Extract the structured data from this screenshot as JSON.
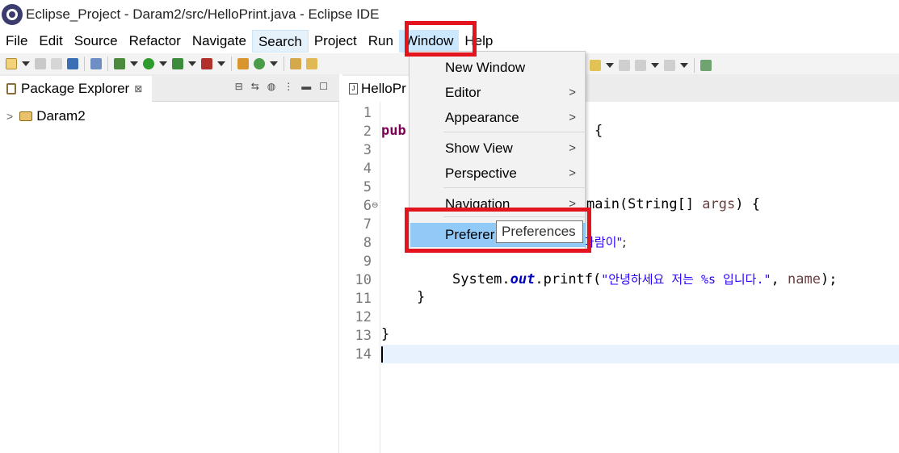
{
  "window": {
    "title": "Eclipse_Project - Daram2/src/HelloPrint.java - Eclipse IDE"
  },
  "menubar": [
    "File",
    "Edit",
    "Source",
    "Refactor",
    "Navigate",
    "Search",
    "Project",
    "Run",
    "Window",
    "Help"
  ],
  "left_panel": {
    "tab_label": "Package Explorer",
    "tab_close": "⊠",
    "project": "Daram2"
  },
  "editor": {
    "tab_label": "HelloPr",
    "line_numbers": [
      "1",
      "2",
      "3",
      "4",
      "5",
      "6",
      "7",
      "8",
      "9",
      "10",
      "11",
      "12",
      "13",
      "14"
    ],
    "lines": {
      "l2_kw": "pub",
      "l2_rest": "{",
      "l6_a": "main(String[] ",
      "l6_var": "args",
      "l6_b": ") {",
      "l8_str": "다람이\"",
      "l8_rest": ";",
      "l10_a": "System.",
      "l10_fld": "out",
      "l10_b": ".printf(",
      "l10_str": "\"안녕하세요 저는 %s 입니다.\"",
      "l10_c": ", ",
      "l10_var": "name",
      "l10_d": ");",
      "l11": "}",
      "l13": "}"
    }
  },
  "window_menu": {
    "items": [
      {
        "label": "New Window",
        "submenu": false
      },
      {
        "label": "Editor",
        "submenu": true
      },
      {
        "label": "Appearance",
        "submenu": true
      },
      {
        "label": "Show View",
        "submenu": true
      },
      {
        "label": "Perspective",
        "submenu": true
      },
      {
        "label": "Navigation",
        "submenu": true
      },
      {
        "label": "Preferer",
        "submenu": false
      }
    ],
    "submenu_glyph": ">"
  },
  "tooltip": "Preferences",
  "colors": {
    "highlight_red": "#e3141e",
    "menu_selected": "#91c9f7",
    "keyword": "#7f0055",
    "string": "#2a00ff"
  }
}
